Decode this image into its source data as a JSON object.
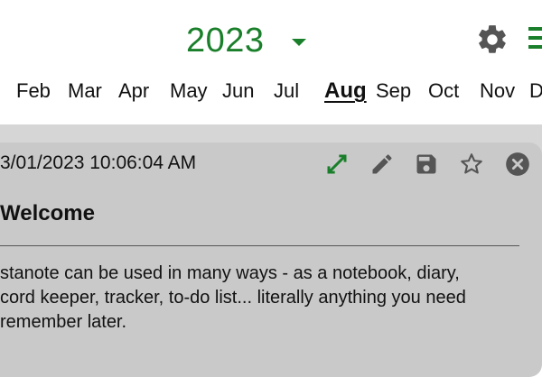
{
  "header": {
    "year": "2023",
    "months": [
      "Feb",
      "Mar",
      "Apr",
      "May",
      "Jun",
      "Jul",
      "Aug",
      "Sep",
      "Oct",
      "Nov",
      "D"
    ],
    "active_month": "Aug"
  },
  "note": {
    "timestamp": "3/01/2023 10:06:04 AM",
    "title": "Welcome",
    "body_lines": [
      "stanote can be used in many ways - as a notebook, diary,",
      "cord keeper, tracker, to-do list... literally anything you need",
      "remember later."
    ]
  },
  "icons": {
    "settings": "gear-icon",
    "menu": "menu-icon",
    "expand": "expand-icon",
    "edit": "pencil-icon",
    "save": "save-icon",
    "favorite": "star-icon",
    "close": "close-icon"
  },
  "colors": {
    "accent": "#1a7f2a",
    "panel": "#d6d6d6",
    "card": "#c9c9c9",
    "icon_gray": "#555555"
  }
}
